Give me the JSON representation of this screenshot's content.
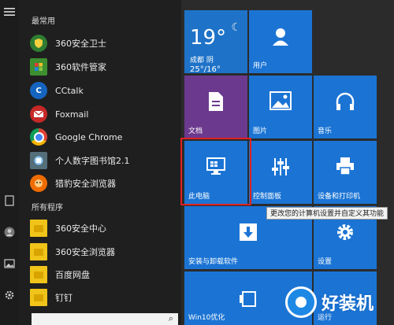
{
  "left_rail": {
    "icons": [
      "hamburger-icon",
      "document-icon",
      "user-icon",
      "picture-icon",
      "gear-icon"
    ]
  },
  "app_list": {
    "most_used_label": "最常用",
    "most_used": [
      {
        "name": "360安全卫士",
        "icon": "360-safe-icon",
        "glyph": ""
      },
      {
        "name": "360软件管家",
        "icon": "360-software-icon",
        "glyph": ""
      },
      {
        "name": "CCtalk",
        "icon": "cctalk-icon",
        "glyph": "C"
      },
      {
        "name": "Foxmail",
        "icon": "foxmail-icon",
        "glyph": ""
      },
      {
        "name": "Google Chrome",
        "icon": "chrome-icon",
        "glyph": ""
      },
      {
        "name": "个人数字图书馆2.1",
        "icon": "library-icon",
        "glyph": ""
      },
      {
        "name": "猎豹安全浏览器",
        "icon": "cheetah-browser-icon",
        "glyph": ""
      }
    ],
    "all_programs_label": "所有程序",
    "all_programs": [
      {
        "name": "360安全中心",
        "icon": "folder-icon"
      },
      {
        "name": "360安全浏览器",
        "icon": "folder-icon"
      },
      {
        "name": "百度网盘",
        "icon": "folder-icon"
      },
      {
        "name": "钉钉",
        "icon": "folder-icon"
      }
    ]
  },
  "search": {
    "icon": "search-icon",
    "glyph": "⌕"
  },
  "tiles": {
    "weather": {
      "temp": "19°",
      "city": "成都 阴",
      "range": "25°/16°",
      "icon": "moon-icon",
      "color": "#1e73c8"
    },
    "user": {
      "label": "用户",
      "icon": "user-icon",
      "color": "#1b74d4"
    },
    "documents": {
      "label": "文档",
      "icon": "document-icon",
      "color": "#6b3a8e"
    },
    "pictures": {
      "label": "图片",
      "icon": "picture-icon",
      "color": "#1b74d4"
    },
    "music": {
      "label": "音乐",
      "icon": "headphones-icon",
      "color": "#1b74d4"
    },
    "this_pc": {
      "label": "此电脑",
      "icon": "monitor-icon",
      "color": "#1b74d4"
    },
    "control_panel": {
      "label": "控制面板",
      "icon": "sliders-icon",
      "color": "#1b74d4"
    },
    "devices_printers": {
      "label": "设备和打印机",
      "icon": "printer-icon",
      "color": "#1b74d4"
    },
    "install_uninstall": {
      "label": "安装与卸载软件",
      "icon": "download-icon",
      "color": "#1b74d4"
    },
    "settings": {
      "label": "设置",
      "icon": "gear-icon",
      "color": "#1b74d4"
    },
    "win10_optimize": {
      "label": "Win10优化",
      "icon": "optimize-icon",
      "color": "#1b74d4"
    },
    "run": {
      "label": "运行",
      "icon": "run-icon",
      "color": "#1b74d4"
    }
  },
  "tooltip": {
    "text": "更改您的计算机设置并自定义其功能"
  },
  "watermark": {
    "text": "好装机",
    "icon": "watermark-logo-icon"
  }
}
